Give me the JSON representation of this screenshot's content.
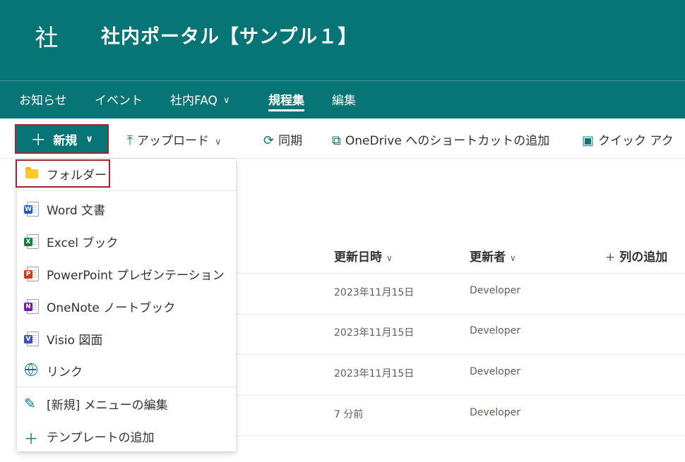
{
  "site": {
    "logo_text": "社",
    "title": "社内ポータル【サンプル１】"
  },
  "nav": {
    "items": [
      {
        "label": "お知らせ"
      },
      {
        "label": "イベント"
      },
      {
        "label": "社内FAQ"
      },
      {
        "label": "規程集"
      },
      {
        "label": "編集"
      }
    ],
    "active_item": "規程集",
    "chevron": "∨"
  },
  "command_bar": {
    "new_label": "新規",
    "upload_label": "アップロード",
    "sync_label": "同期",
    "onedrive_shortcut_label": "OneDrive へのショートカットの追加",
    "quick_action_label": "クイック アク"
  },
  "new_menu": {
    "items": [
      {
        "label": "フォルダー",
        "icon": "folder-icon"
      },
      {
        "label": "Word 文書",
        "icon": "word-icon"
      },
      {
        "label": "Excel ブック",
        "icon": "excel-icon"
      },
      {
        "label": "PowerPoint プレゼンテーション",
        "icon": "powerpoint-icon"
      },
      {
        "label": "OneNote ノートブック",
        "icon": "onenote-icon"
      },
      {
        "label": "Visio 図面",
        "icon": "visio-icon"
      },
      {
        "label": "リンク",
        "icon": "globe-icon"
      },
      {
        "label": "[新規] メニューの編集",
        "icon": "pencil-icon"
      },
      {
        "label": "テンプレートの追加",
        "icon": "plus-icon"
      }
    ]
  },
  "table": {
    "columns": {
      "modified": "更新日時",
      "modified_by": "更新者",
      "add_column": "列の追加"
    },
    "rows": [
      {
        "modified": "2023年11月15日",
        "modified_by": "Developer"
      },
      {
        "modified": "2023年11月15日",
        "modified_by": "Developer"
      },
      {
        "modified": "2023年11月15日",
        "modified_by": "Developer"
      },
      {
        "modified": "7 分前",
        "modified_by": "Developer"
      }
    ]
  },
  "colors": {
    "theme": "#077575",
    "highlight_border": "#a4262c"
  }
}
